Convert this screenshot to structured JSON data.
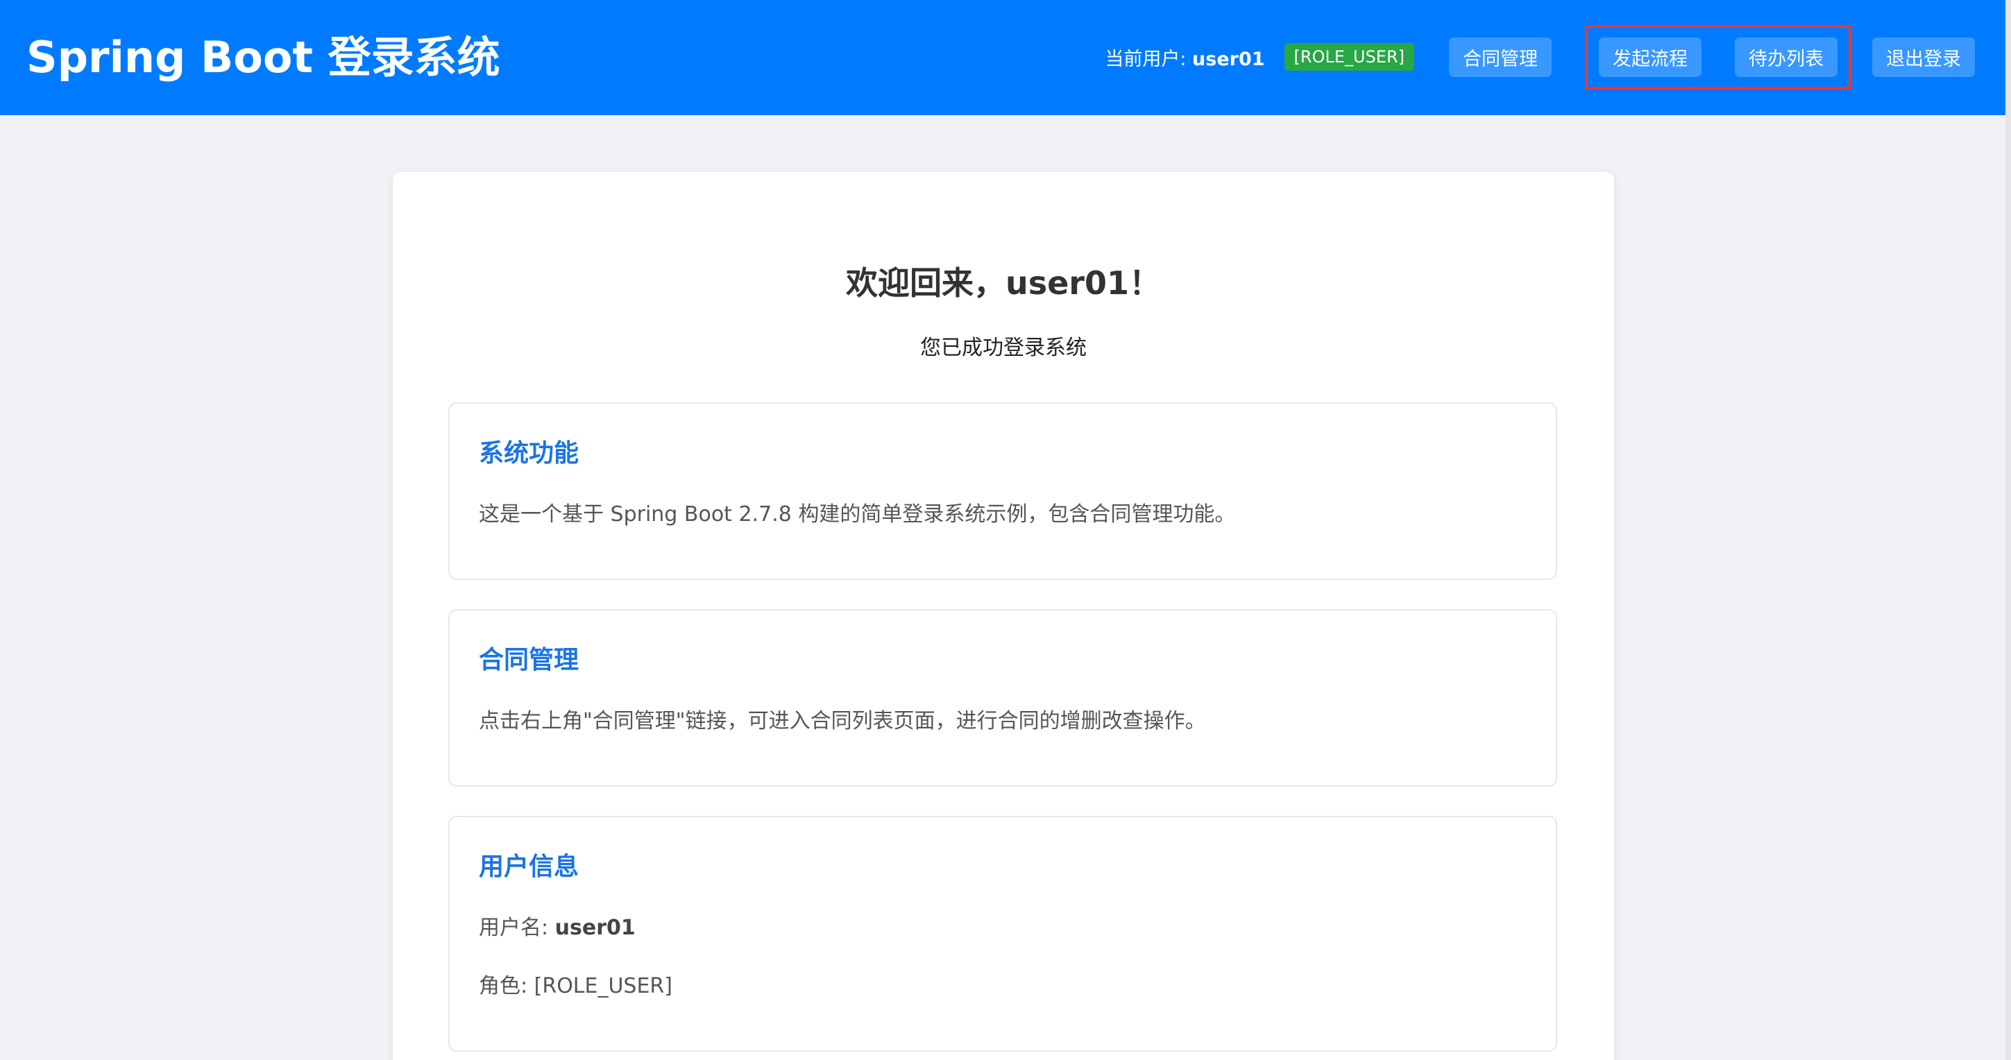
{
  "header": {
    "brand": "Spring Boot 登录系统",
    "current_user_label": "当前用户: ",
    "current_user_name": "user01",
    "role_badge": "[ROLE_USER]",
    "nav": {
      "contracts": "合同管理",
      "start_process": "发起流程",
      "todo_list": "待办列表",
      "logout": "退出登录"
    }
  },
  "main": {
    "welcome_title": "欢迎回来，user01！",
    "welcome_sub": "您已成功登录系统",
    "sections": [
      {
        "title": "系统功能",
        "text": "这是一个基于 Spring Boot 2.7.8 构建的简单登录系统示例，包含合同管理功能。"
      },
      {
        "title": "合同管理",
        "text": "点击右上角\"合同管理\"链接，可进入合同列表页面，进行合同的增删改查操作。"
      },
      {
        "title": "用户信息",
        "username_label": "用户名: ",
        "username": "user01",
        "role_line": "角色: [ROLE_USER]"
      }
    ]
  },
  "colors": {
    "header_bg": "#007bff",
    "role_badge_bg": "#28a745",
    "section_title": "#1a73e8",
    "highlight_border": "#e5383b",
    "page_bg": "#f0f2f5"
  }
}
